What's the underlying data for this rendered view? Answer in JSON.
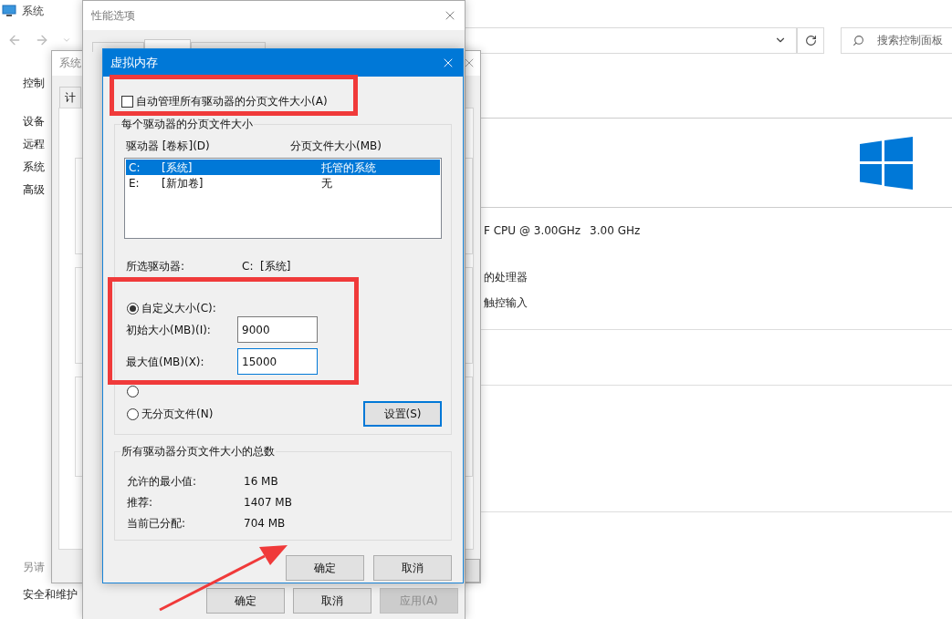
{
  "control_panel": {
    "title": "系统",
    "search": {
      "placeholder": "搜索控制面板"
    },
    "sidebar": {
      "home": "控制",
      "items": [
        "设备",
        "远程",
        "系统",
        "高级"
      ],
      "see_also": {
        "heading": "另请",
        "items": [
          "安全和维护"
        ]
      }
    },
    "processor": {
      "name": "F CPU @ 3.00GHz",
      "speed": "3.00 GHz"
    },
    "info_lines": [
      "的处理器",
      "触控输入"
    ]
  },
  "system_properties": {
    "title": "系统",
    "tab_label": "计"
  },
  "performance_options": {
    "title": "性能选项",
    "tabs": [
      {
        "selected": false
      },
      {
        "selected": true
      },
      {
        "selected": false
      }
    ],
    "buttons": [
      {
        "label": "确定",
        "disabled": false
      },
      {
        "label": "取消",
        "disabled": false
      },
      {
        "label": "应用(A)",
        "disabled": true
      }
    ]
  },
  "virtual_memory": {
    "title": "虚拟内存",
    "auto_manage": {
      "label": "自动管理所有驱动器的分页文件大小(A)",
      "checked": false
    },
    "per_drive": {
      "title": "每个驱动器的分页文件大小",
      "columns": [
        "驱动器 [卷标](D)",
        "分页文件大小(MB)"
      ],
      "drives": [
        {
          "letter": "C:",
          "label": "[系统]",
          "size": "托管的系统",
          "selected": true
        },
        {
          "letter": "E:",
          "label": "[新加卷]",
          "size": "无",
          "selected": false
        }
      ],
      "selected_drive": {
        "label": "所选驱动器:",
        "value": "C:  [系统]"
      },
      "options": [
        {
          "kind": "custom",
          "label": "自定义大小(C):",
          "selected": true
        },
        {
          "kind": "system",
          "selected": false
        },
        {
          "kind": "none",
          "label": "无分页文件(N)",
          "selected": false
        }
      ],
      "initial": {
        "label": "初始大小(MB)(I):",
        "value": "9000",
        "focused": false
      },
      "maximum": {
        "label": "最大值(MB)(X):",
        "value": "15000",
        "focused": true
      },
      "set_button": "设置(S)"
    },
    "totals": {
      "title": "所有驱动器分页文件大小的总数",
      "rows": [
        {
          "label": "允许的最小值:",
          "value": "16 MB"
        },
        {
          "label": "推荐:",
          "value": "1407 MB"
        },
        {
          "label": "当前已分配:",
          "value": "704 MB"
        }
      ]
    },
    "buttons": [
      "确定",
      "取消"
    ]
  },
  "annotations": [
    {
      "kind": "frame"
    },
    {
      "kind": "frame"
    },
    {
      "kind": "arrow"
    }
  ]
}
